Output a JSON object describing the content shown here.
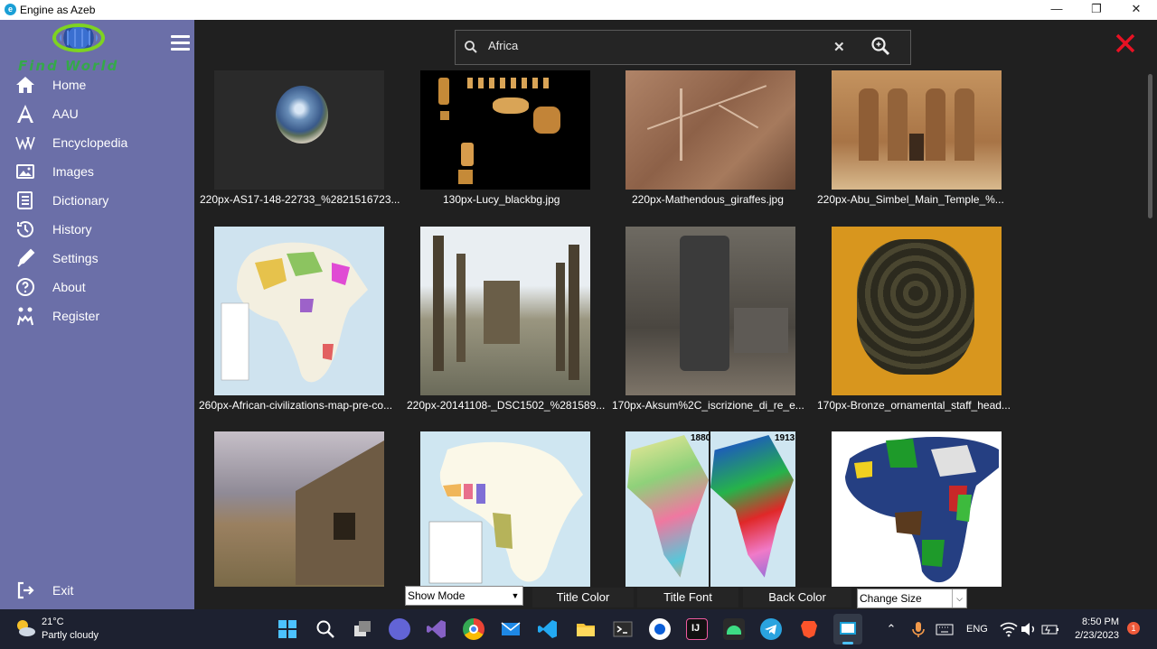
{
  "window": {
    "title": "Engine as Azeb",
    "min": "—",
    "max": "❐",
    "close": "✕"
  },
  "logo": {
    "text": "Find World"
  },
  "nav": {
    "items": [
      {
        "label": "Home"
      },
      {
        "label": "AAU"
      },
      {
        "label": "Encyclopedia"
      },
      {
        "label": "Images"
      },
      {
        "label": "Dictionary"
      },
      {
        "label": "History"
      },
      {
        "label": "Settings"
      },
      {
        "label": "About"
      },
      {
        "label": "Register"
      }
    ],
    "exit": "Exit"
  },
  "search": {
    "query": "Africa"
  },
  "results": [
    {
      "caption": "220px-AS17-148-22733_%2821516723..."
    },
    {
      "caption": "130px-Lucy_blackbg.jpg"
    },
    {
      "caption": "220px-Mathendous_giraffes.jpg"
    },
    {
      "caption": "220px-Abu_Simbel_Main_Temple_%..."
    },
    {
      "caption": "260px-African-civilizations-map-pre-co..."
    },
    {
      "caption": "220px-20141108-_DSC1502_%281589..."
    },
    {
      "caption": "170px-Aksum%2C_iscrizione_di_re_e..."
    },
    {
      "caption": "170px-Bronze_ornamental_staff_head..."
    },
    {
      "caption": ""
    },
    {
      "caption": ""
    },
    {
      "caption": ""
    },
    {
      "caption": ""
    }
  ],
  "map_labels": {
    "y1880": "1880",
    "y1913": "1913"
  },
  "controls": {
    "show_mode": "Show Mode",
    "title_color": "Title Color",
    "title_font": "Title Font",
    "back_color": "Back Color",
    "change_size": "Change Size"
  },
  "taskbar": {
    "temp": "21°C",
    "weather": "Partly cloudy",
    "lang": "ENG",
    "time": "8:50 PM",
    "date": "2/23/2023",
    "notifications": "1"
  },
  "colors": {
    "sidebar": "#6b6fa8",
    "content_bg": "#202020",
    "close_accent": "#e81123"
  }
}
